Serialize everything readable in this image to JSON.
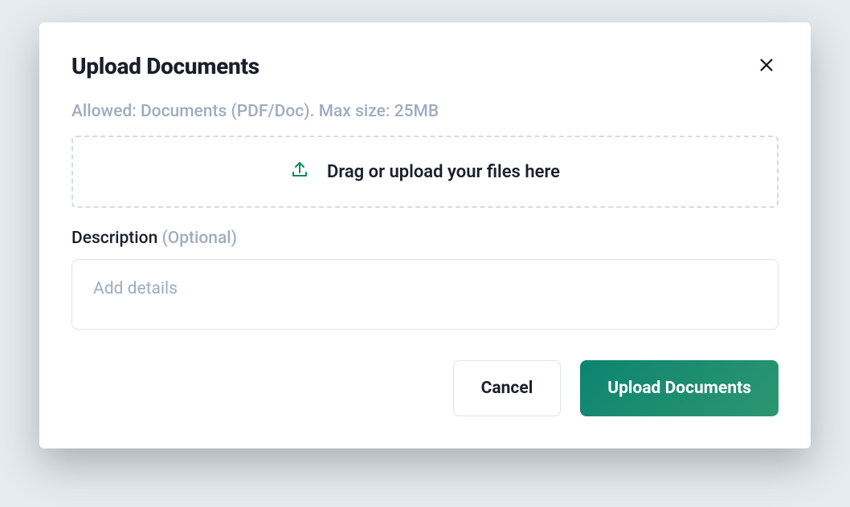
{
  "modal": {
    "title": "Upload Documents",
    "allowed_text": "Allowed: Documents (PDF/Doc). Max size: 25MB",
    "dropzone_text": "Drag or upload your files here",
    "description_label": "Description",
    "description_optional": "(Optional)",
    "description_placeholder": "Add details",
    "description_value": "",
    "cancel_label": "Cancel",
    "submit_label": "Upload Documents"
  }
}
